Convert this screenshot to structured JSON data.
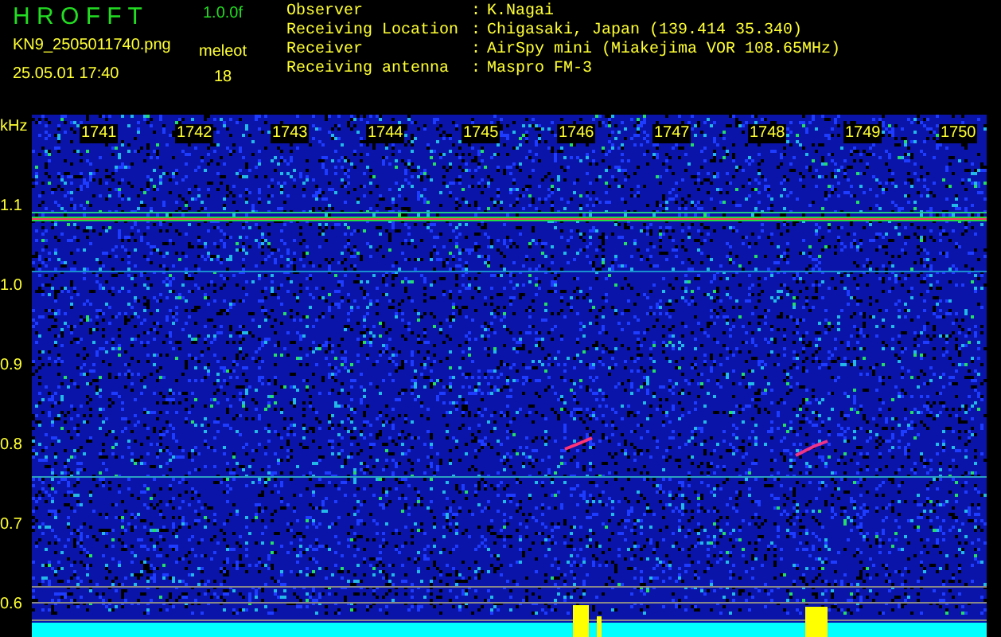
{
  "header": {
    "title": "H R O F F T",
    "version": "1.0.0f",
    "file_name": "KN9_2505011740.png",
    "timestamp": "25.05.01 17:40",
    "count_label": "meleot",
    "count": "18"
  },
  "info": [
    {
      "label": "Observer",
      "separator": ":",
      "value": "K.Nagai"
    },
    {
      "label": "Receiving Location",
      "separator": ":",
      "value": "Chigasaki, Japan (139.414 35.340)"
    },
    {
      "label": "Receiver",
      "separator": ":",
      "value": "AirSpy mini (Miakejima VOR 108.65MHz)"
    },
    {
      "label": "Receiving antenna",
      "separator": ":",
      "value": "Maspro FM-3"
    }
  ],
  "spectrogram": {
    "y_unit": "kHz",
    "y_labels": [
      "1.1",
      "1.0",
      "0.9",
      "0.8",
      "0.7",
      "0.6"
    ],
    "x_labels": [
      "1741",
      "1742",
      "1743",
      "1744",
      "1745",
      "1746",
      "1747",
      "1748",
      "1749",
      "1750"
    ]
  }
}
